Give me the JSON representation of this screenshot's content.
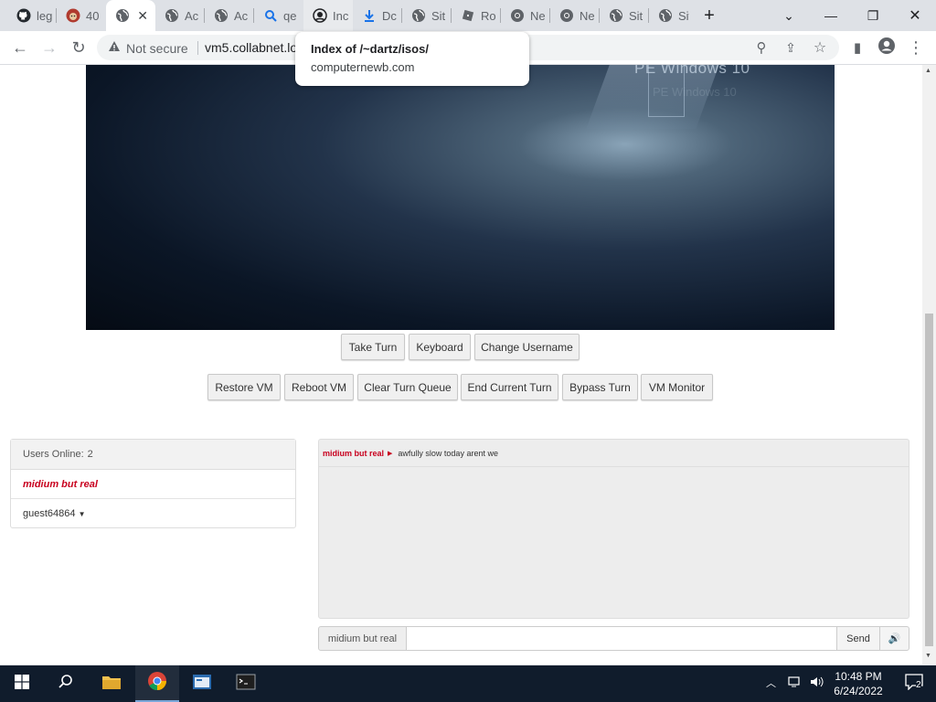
{
  "browser": {
    "tabs": [
      {
        "label": "leg",
        "icon": "github-icon"
      },
      {
        "label": "40",
        "icon": "dog-icon"
      },
      {
        "label": "",
        "icon": "globe-icon",
        "active": true
      },
      {
        "label": "Ac",
        "icon": "globe-icon"
      },
      {
        "label": "Ac",
        "icon": "globe-icon"
      },
      {
        "label": "qe",
        "icon": "search-icon"
      },
      {
        "label": "Inc",
        "icon": "site-icon"
      },
      {
        "label": "Dc",
        "icon": "download-icon"
      },
      {
        "label": "Sit",
        "icon": "globe-icon"
      },
      {
        "label": "Ro",
        "icon": "roblox-icon"
      },
      {
        "label": "Ne",
        "icon": "chrome-icon"
      },
      {
        "label": "Ne",
        "icon": "chrome-icon"
      },
      {
        "label": "Sit",
        "icon": "globe-icon"
      },
      {
        "label": "Sit",
        "icon": "globe-icon"
      }
    ],
    "security_label": "Not secure",
    "url": "vm5.collabnet.lo",
    "tooltip": {
      "title": "Index of /~dartz/isos/",
      "domain": "computernewb.com"
    }
  },
  "vm": {
    "screen_logo": "PE Windows 10",
    "controls_row1": [
      "Take Turn",
      "Keyboard",
      "Change Username"
    ],
    "controls_row2": [
      "Restore VM",
      "Reboot VM",
      "Clear Turn Queue",
      "End Current Turn",
      "Bypass Turn",
      "VM Monitor"
    ]
  },
  "users": {
    "header_label": "Users Online:",
    "count": "2",
    "list": [
      {
        "name": "midium but real",
        "has_turn": true
      },
      {
        "name": "guest64864",
        "has_turn": false
      }
    ]
  },
  "chat": {
    "messages": [
      {
        "user": "midium but real",
        "text": "awfully slow today arent we"
      }
    ],
    "username_label": "midium but real",
    "input_value": "",
    "send_label": "Send"
  },
  "taskbar": {
    "time": "10:48 PM",
    "date": "6/24/2022",
    "notification_count": "2"
  },
  "colors": {
    "turn_user": "#c8001e",
    "taskbar": "#101c2c",
    "chat_bg": "#ededed"
  }
}
